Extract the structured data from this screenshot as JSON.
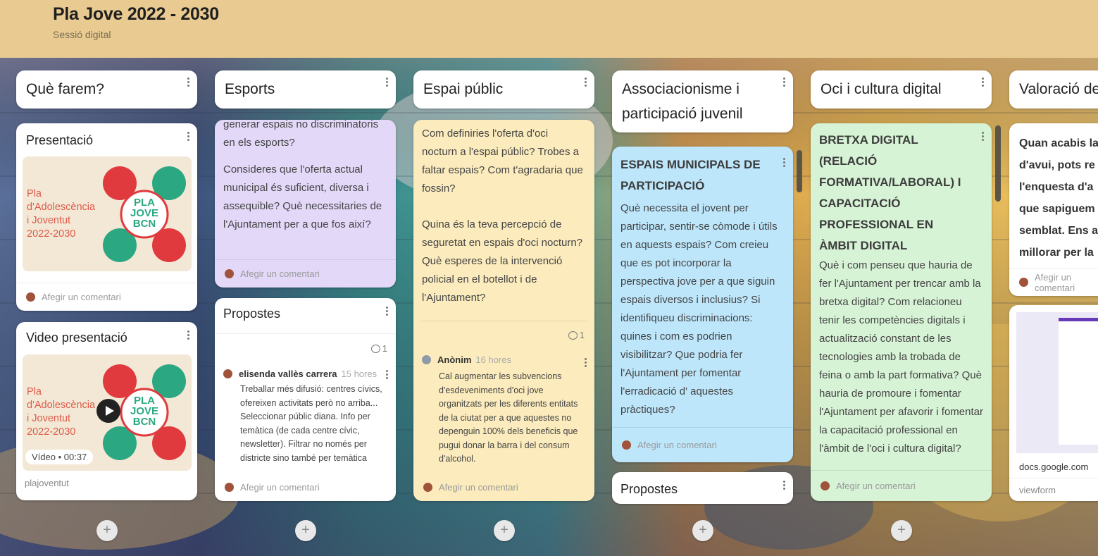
{
  "header": {
    "title": "Pla Jove 2022 - 2030",
    "subtitle": "Sessió digital"
  },
  "colors": {
    "header_bg": "#e9cb92",
    "purple_card": "#e3d8f8",
    "yellow_card": "#fbebbd",
    "blue_card": "#bde6fb",
    "green_card": "#d7f3d6"
  },
  "add_comment": "Afegir un comentari",
  "columns": [
    {
      "title": "Què farem?",
      "cards": [
        {
          "title": "Presentació",
          "image_text": "Pla\nd'Adolescència\ni Joventut\n2022-2030",
          "logo_text": "PLA\nJOVE\nBCN"
        },
        {
          "title": "Video presentació",
          "video_meta": "Vídeo • 00:37",
          "source": "plajoventut"
        }
      ]
    },
    {
      "title": "Esports",
      "cards": [
        {
          "body": [
            "generar espais no discriminatoris en els esports?",
            "Consideres que l'oferta actual municipal és suficient, diversa i assequible? Què necessitaries de l'Ajuntament per a que fos així?"
          ]
        },
        {
          "title": "Propostes",
          "comment_count": "1",
          "author": "elisenda vallès carrera",
          "time": "15 hores",
          "text": "Treballar més difusió: centres cívics, ofereixen activitats però no arriba... Seleccionar públic diana. Info per temàtica (de cada centre cívic, newsletter). Filtrar no només per districte sino també per temàtica"
        }
      ]
    },
    {
      "title": "Espai públic",
      "cards": [
        {
          "body": [
            "Com definiries l'oferta d'oci nocturn a l'espai públic? Trobes a faltar espais? Com t'agradaria que fossin?",
            "Quina és la teva percepció de seguretat en espais d'oci nocturn? Què esperes de la intervenció policial en el botellot i de l'Ajuntament?"
          ],
          "comment_count": "1",
          "author": "Anònim",
          "time": "16 hores",
          "text": "Cal augmentar les subvencions d'esdeveniments d'oci jove organitzats per les diferents entitats de la ciutat per a que aquestes no depenguin 100% dels beneficis que pugui donar la barra i del consum d'alcohol."
        }
      ]
    },
    {
      "title": "Associacionisme i participació juvenil",
      "cards": [
        {
          "heading": "ESPAIS MUNICIPALS DE PARTICIPACIÓ",
          "body": "Què necessita el jovent per participar, sentir-se còmode i útils en aquests espais? Com creieu que es pot incorporar la perspectiva jove per a que siguin espais diversos i inclusius? Si identifiqueu discriminacions: quines i com es podrien visibilitzar? Que podria fer l'Ajuntament per fomentar l'erradicació d' aquestes pràctiques?"
        },
        {
          "title": "Propostes"
        }
      ]
    },
    {
      "title": "Oci i cultura digital",
      "cards": [
        {
          "heading": "BRETXA DIGITAL (RELACIÓ FORMATIVA/LABORAL) I CAPACITACIÓ PROFESSIONAL EN ÀMBIT DIGITAL",
          "body": "Què i com penseu que hauria de fer l'Ajuntament per trencar amb la bretxa digital? Com relacioneu tenir les competències digitals i actualització constant de les tecnologies amb la trobada de feina o amb la part formativa? Què hauria de promoure i fomentar l'Ajuntament per afavorir i fomentar la capacitació professional en l'àmbit de l'oci i cultura digital?"
        }
      ]
    },
    {
      "title": "Valoració de",
      "cards": [
        {
          "body": "Quan acabis la d'avui, pots re l'enquesta d'a que sapiguem semblat. Ens a millorar per la"
        },
        {
          "link_domain": "docs.google.com",
          "link_path": "viewform"
        }
      ]
    }
  ]
}
